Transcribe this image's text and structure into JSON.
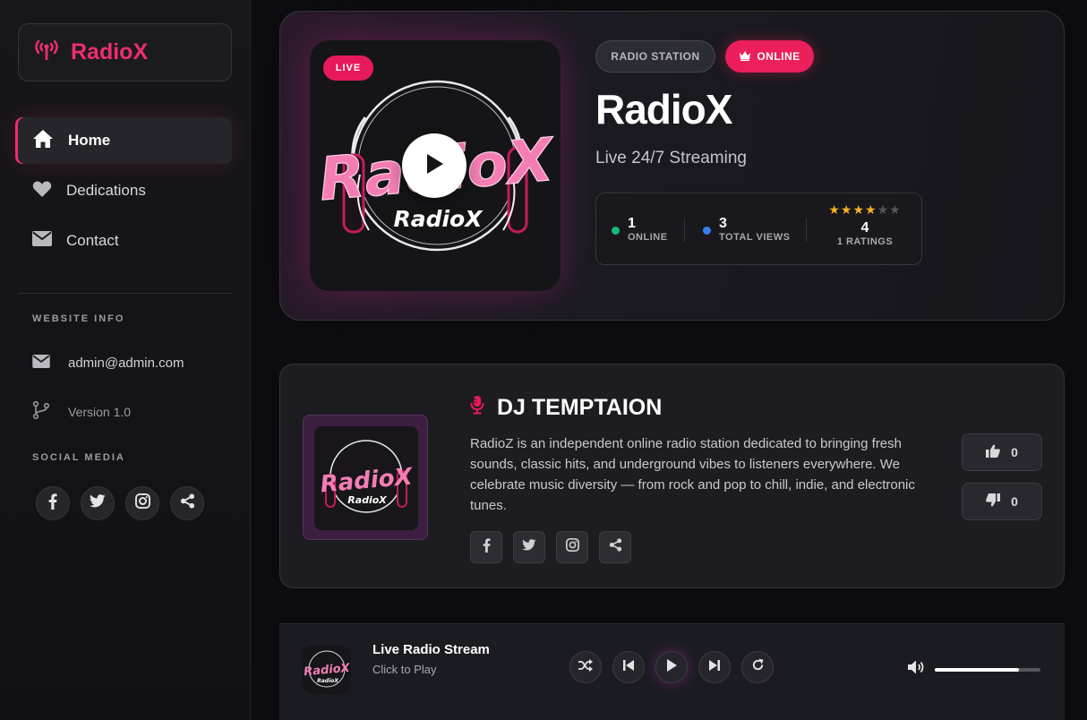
{
  "brand": {
    "name": "RadioX"
  },
  "sidebar": {
    "nav": [
      {
        "label": "Home",
        "icon": "home-icon",
        "active": true
      },
      {
        "label": "Dedications",
        "icon": "heart-icon",
        "active": false
      },
      {
        "label": "Contact",
        "icon": "envelope-icon",
        "active": false
      }
    ],
    "website_info_label": "WEBSITE INFO",
    "email": "admin@admin.com",
    "version": "Version 1.0",
    "social_label": "SOCIAL MEDIA",
    "social": [
      "facebook-icon",
      "twitter-icon",
      "instagram-icon",
      "share-icon"
    ]
  },
  "hero": {
    "live_badge": "LIVE",
    "cover_text": "RadioX",
    "tag_station": "RADIO STATION",
    "tag_online": "ONLINE",
    "title": "RadioX",
    "subtitle": "Live 24/7 Streaming",
    "stats": {
      "online_count": "1",
      "online_label": "ONLINE",
      "views_count": "3",
      "views_label": "TOTAL VIEWS",
      "stars_filled": 4,
      "stars_total": 6,
      "rating_value": "4",
      "rating_label": "1 RATINGS"
    }
  },
  "dj": {
    "name": "DJ TEMPTAION",
    "logo_text": "RadioX",
    "description": "RadioZ is an independent online radio station dedicated to bringing fresh sounds, classic hits, and underground vibes to listeners everywhere. We celebrate music diversity — from rock and pop to chill, indie, and electronic tunes.",
    "likes": "0",
    "dislikes": "0"
  },
  "player": {
    "title": "Live Radio Stream",
    "subtitle": "Click to Play",
    "thumb_text": "RadioX",
    "volume": 0.8
  },
  "colors": {
    "accent": "#ee2d6f",
    "online_dot": "#18b87a",
    "views_dot": "#3d7df2",
    "star": "#f5b321"
  }
}
